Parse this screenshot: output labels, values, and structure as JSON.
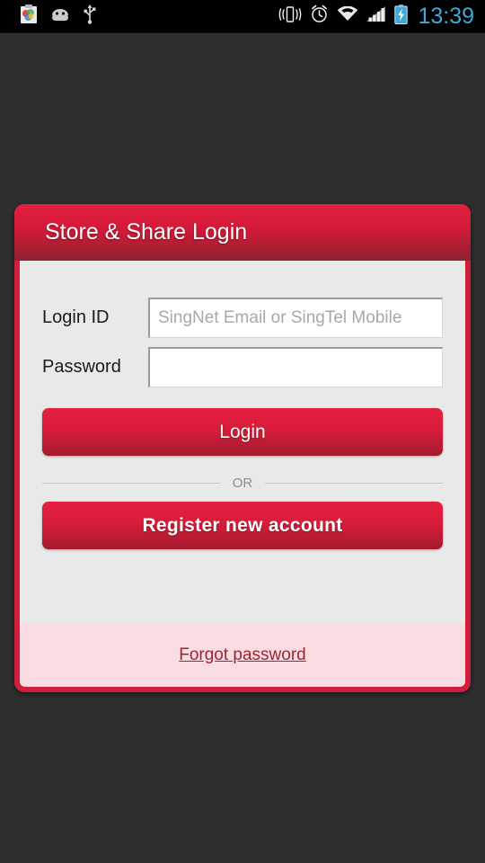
{
  "statusbar": {
    "time": "13:39",
    "left_icons": [
      {
        "name": "gallery-icon",
        "label": "Gallery"
      },
      {
        "name": "android-icon",
        "label": "Android"
      },
      {
        "name": "usb-icon",
        "label": "USB"
      }
    ],
    "right_icons": [
      {
        "name": "vibrate-icon",
        "label": "Vibrate"
      },
      {
        "name": "alarm-icon",
        "label": "Alarm"
      },
      {
        "name": "wifi-icon",
        "label": "WiFi"
      },
      {
        "name": "signal-icon",
        "label": "Signal"
      },
      {
        "name": "battery-charging-icon",
        "label": "Battery charging"
      }
    ]
  },
  "card": {
    "header_title": "Store & Share Login",
    "form": {
      "login_id": {
        "label": "Login ID",
        "placeholder": "SingNet Email or SingTel Mobile",
        "value": ""
      },
      "password": {
        "label": "Password",
        "placeholder": "",
        "value": ""
      }
    },
    "login_button": "Login",
    "divider_text": "OR",
    "register_button": "Register new account",
    "forgot_link": "Forgot password"
  },
  "colors": {
    "background": "#2e2e2e",
    "accent_red": "#d41a38",
    "header_gradient_top": "#e31f41",
    "header_gradient_bottom": "#8b2233",
    "card_body": "#e8e9e9",
    "footer_pink": "#f8dce1",
    "link_red": "#9e2430",
    "status_clock_blue": "#3fa9d8"
  }
}
